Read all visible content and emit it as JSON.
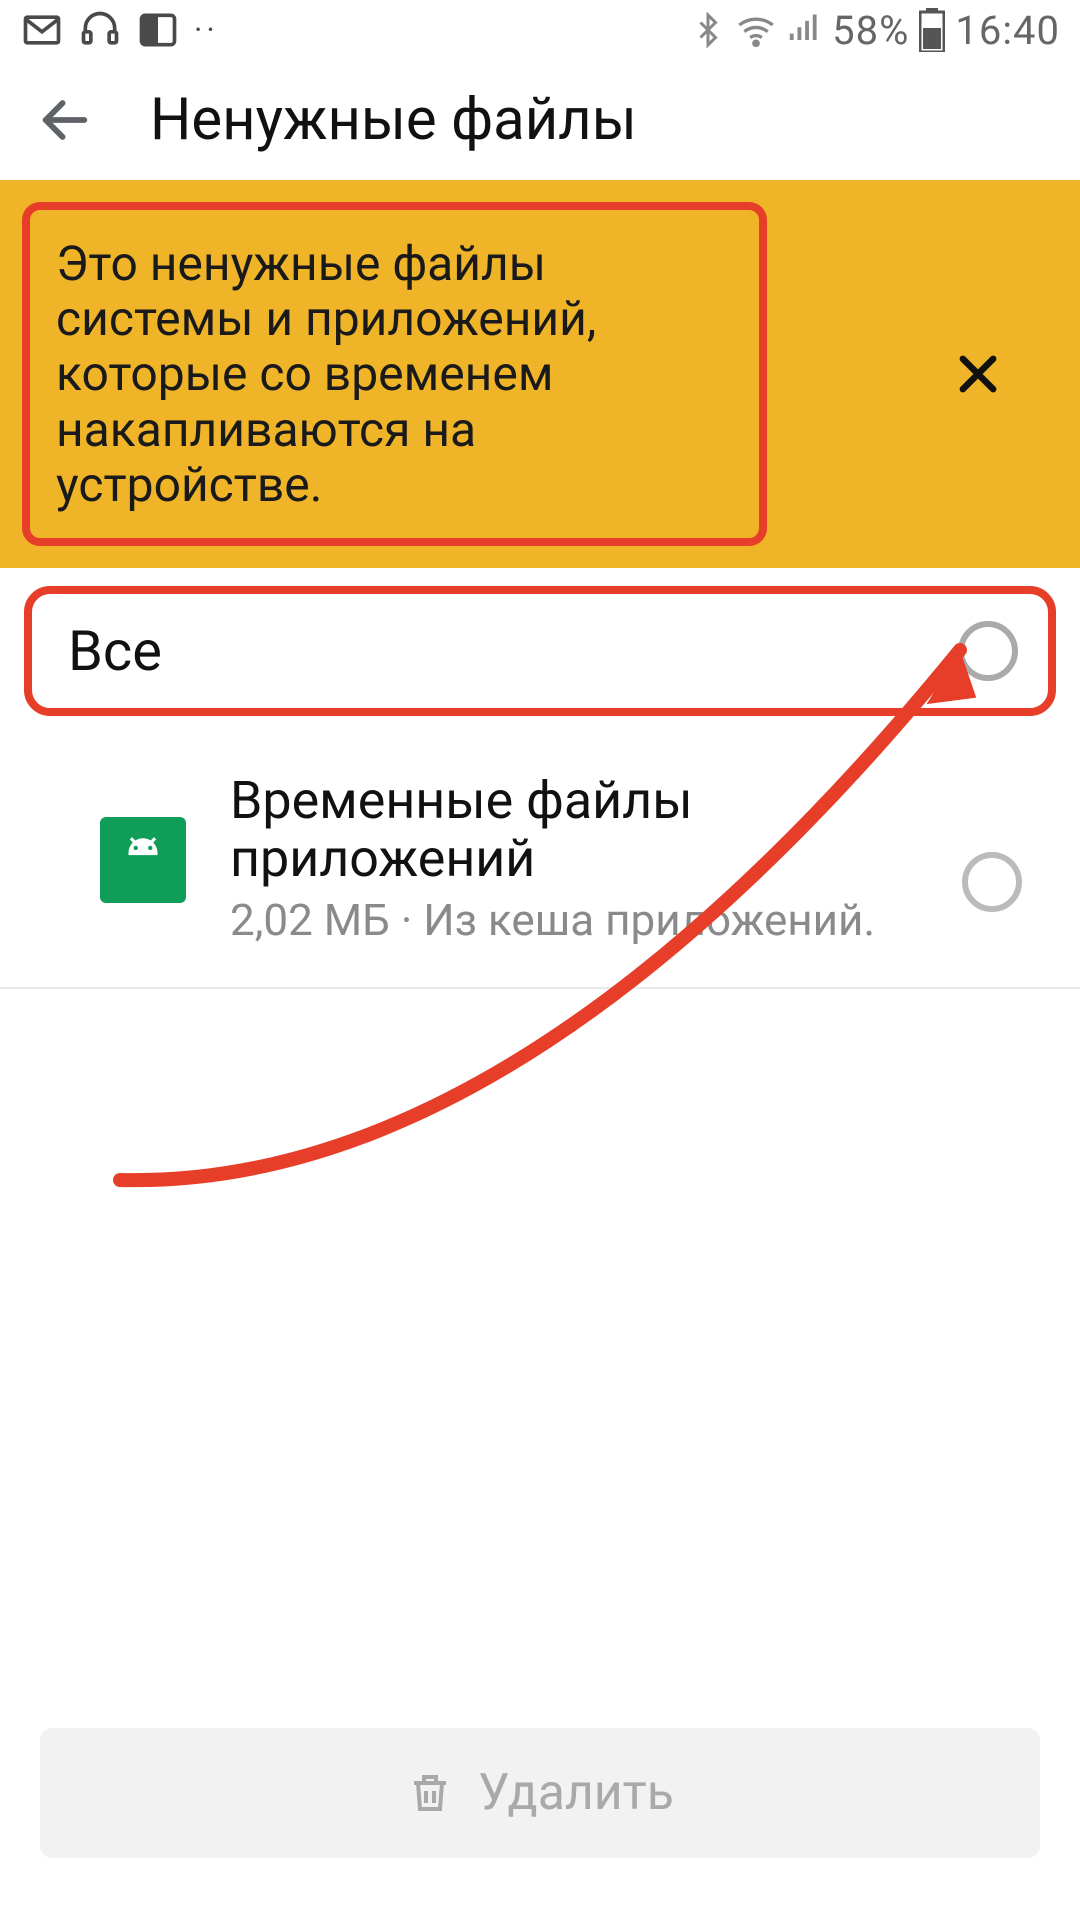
{
  "status_bar": {
    "battery": "58%",
    "time": "16:40"
  },
  "header": {
    "title": "Ненужные файлы"
  },
  "banner": {
    "text": "Это ненужные файлы системы и приложений, которые со временем накапливаются на устройстве."
  },
  "select_all": {
    "label": "Все"
  },
  "items": [
    {
      "title": "Временные файлы приложений",
      "subtitle": "2,02 МБ · Из кеша приложений."
    }
  ],
  "bottom": {
    "delete_label": "Удалить"
  },
  "colors": {
    "banner_bg": "#f0b429",
    "annotation_red": "#e63e28",
    "android_green": "#0f9d58"
  }
}
